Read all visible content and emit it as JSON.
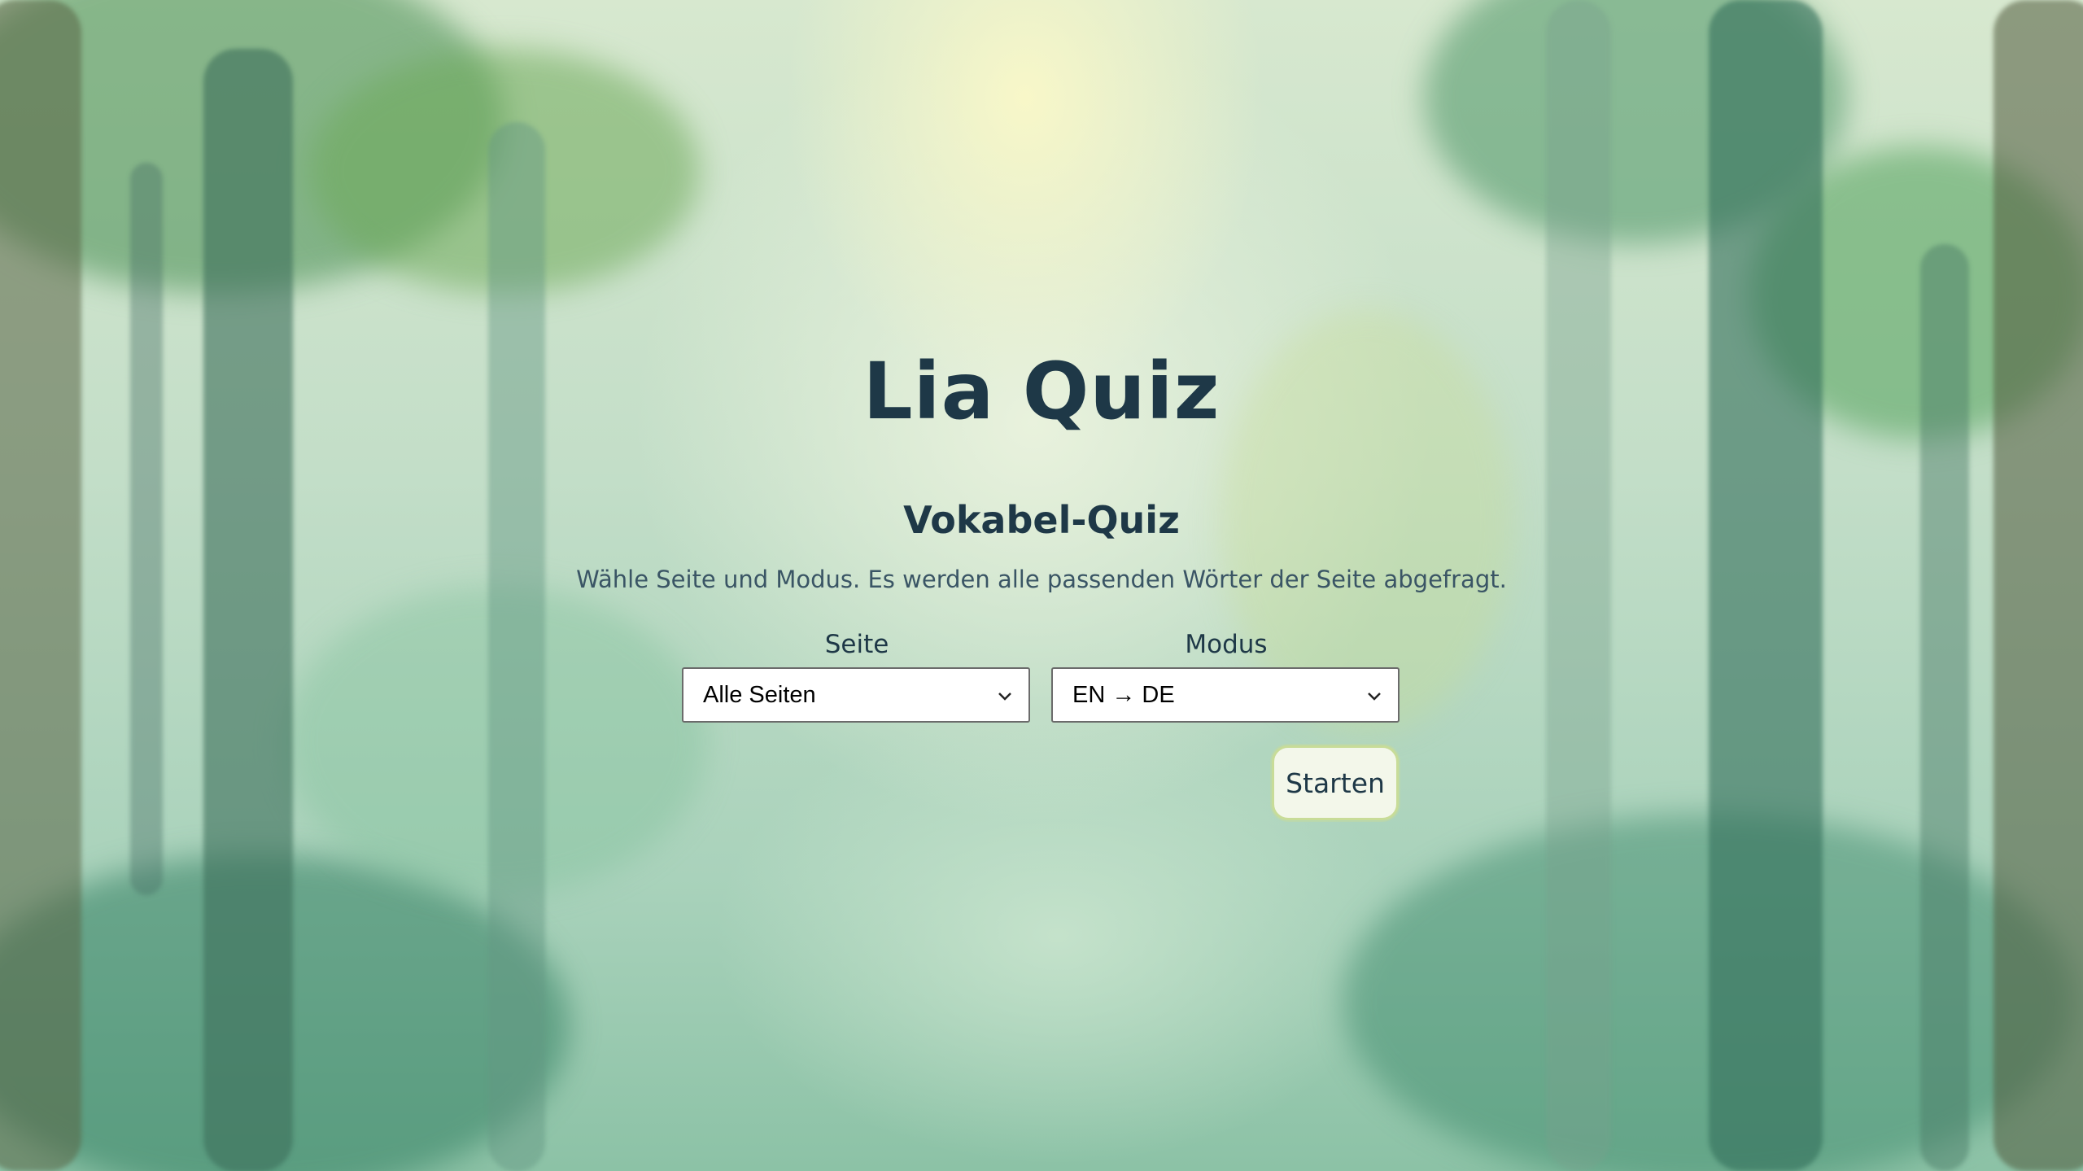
{
  "app": {
    "title": "Lia Quiz"
  },
  "quiz": {
    "heading": "Vokabel-Quiz",
    "description": "Wähle Seite und Modus. Es werden alle passenden Wörter der Seite abgefragt.",
    "page_select": {
      "label": "Seite",
      "selected": "Alle Seiten"
    },
    "mode_select": {
      "label": "Modus",
      "selected": "EN → DE"
    },
    "start_label": "Starten"
  },
  "colors": {
    "text": "#1e3847",
    "button_bg": "#f3f7ea",
    "button_border": "#c8dc98"
  },
  "icons": {
    "select_arrow": "chevron-down-icon"
  }
}
